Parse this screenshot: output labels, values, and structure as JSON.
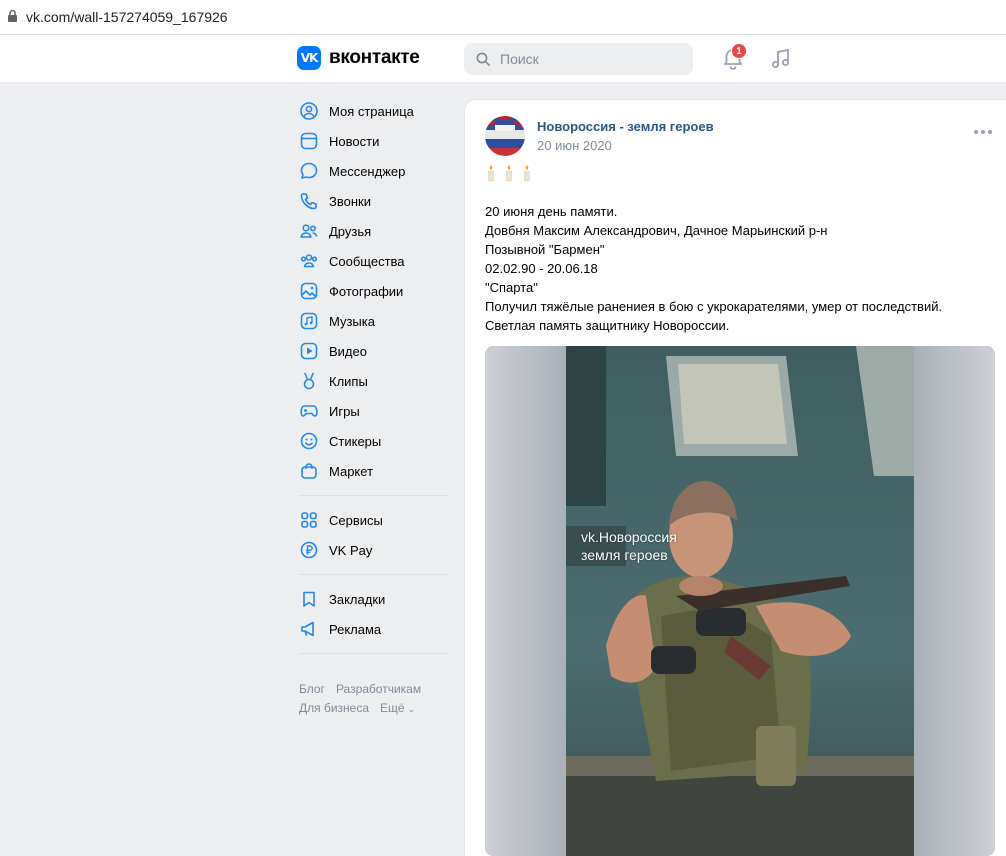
{
  "browser": {
    "url": "vk.com/wall-157274059_167926"
  },
  "header": {
    "logo_mark": "VK",
    "logo_text": "вконтакте",
    "search_placeholder": "Поиск",
    "notifications_count": "1"
  },
  "nav": {
    "items": [
      {
        "label": "Моя страница",
        "icon": "user-circle-icon"
      },
      {
        "label": "Новости",
        "icon": "news-icon"
      },
      {
        "label": "Мессенджер",
        "icon": "message-icon"
      },
      {
        "label": "Звонки",
        "icon": "phone-icon"
      },
      {
        "label": "Друзья",
        "icon": "friends-icon"
      },
      {
        "label": "Сообщества",
        "icon": "communities-icon"
      },
      {
        "label": "Фотографии",
        "icon": "photo-icon"
      },
      {
        "label": "Музыка",
        "icon": "music-icon"
      },
      {
        "label": "Видео",
        "icon": "video-icon"
      },
      {
        "label": "Клипы",
        "icon": "clips-icon"
      },
      {
        "label": "Игры",
        "icon": "gamepad-icon"
      },
      {
        "label": "Стикеры",
        "icon": "smile-icon"
      },
      {
        "label": "Маркет",
        "icon": "bag-icon"
      }
    ],
    "items2": [
      {
        "label": "Сервисы",
        "icon": "services-icon"
      },
      {
        "label": "VK Pay",
        "icon": "ruble-icon"
      }
    ],
    "items3": [
      {
        "label": "Закладки",
        "icon": "bookmark-icon"
      },
      {
        "label": "Реклама",
        "icon": "megaphone-icon"
      }
    ],
    "footer": [
      "Блог",
      "Разработчикам",
      "Для бизнеса",
      "Ещё"
    ]
  },
  "post": {
    "group_name": "Новороссия - земля героев",
    "date": "20 июн 2020",
    "lines": [
      "20 июня день памяти.",
      "Довбня Максим Александрович, Дачное Марьинский р-н",
      "Позывной \"Бармен\"",
      "02.02.90 - 20.06.18",
      "\"Спарта\"",
      "Получил тяжёлые ранениея в бою с укрокарателями, умер от последствий.",
      "Светлая память защитнику Новороссии."
    ],
    "watermark_line1": "vk.Новороссия",
    "watermark_line2": "земля героев"
  },
  "colors": {
    "accent": "#0077ff",
    "link": "#2a5885",
    "badge": "#e64646"
  }
}
